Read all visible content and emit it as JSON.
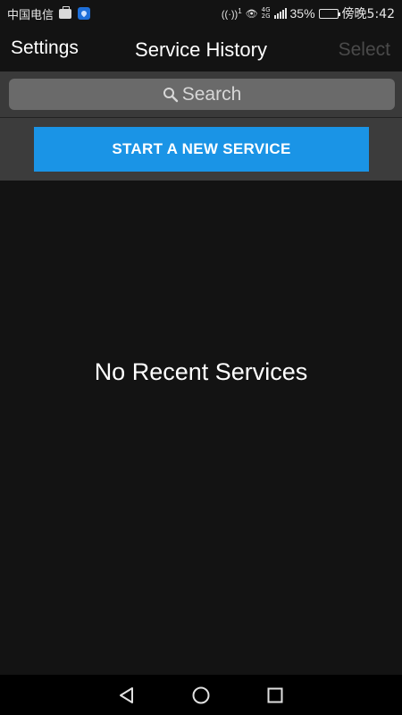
{
  "status_bar": {
    "carrier": "中国电信",
    "signal_badge": "1",
    "network": [
      "4G",
      "2G"
    ],
    "battery_percent": "35%",
    "battery_level": 0.35,
    "time": "傍晚5:42"
  },
  "nav": {
    "left_label": "Settings",
    "title": "Service History",
    "right_label": "Select"
  },
  "search": {
    "placeholder": "Search"
  },
  "actions": {
    "new_service_label": "START A NEW SERVICE"
  },
  "empty_state": {
    "message": "No Recent Services"
  },
  "colors": {
    "accent": "#1a94e6",
    "background": "#131313",
    "toolbar": "#3c3c3c",
    "disabled_text": "#4a4a4a"
  },
  "icons": {
    "search": "search-icon",
    "back": "back-triangle-icon",
    "home": "home-circle-icon",
    "recents": "recents-square-icon"
  }
}
